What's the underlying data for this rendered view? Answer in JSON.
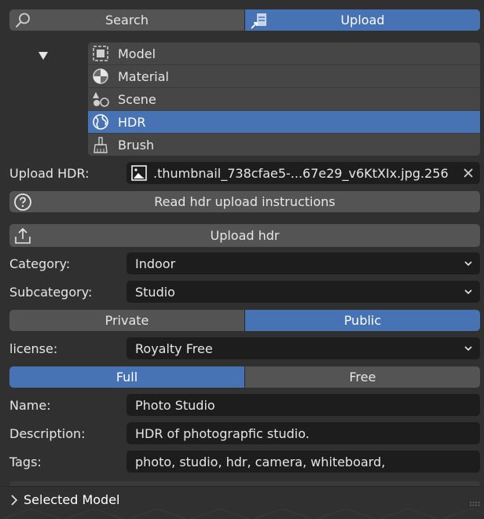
{
  "header": {
    "search_label": "Search",
    "upload_label": "Upload",
    "active": "Upload"
  },
  "asset_types": [
    {
      "label": "Model",
      "icon": "model-icon"
    },
    {
      "label": "Material",
      "icon": "material-icon"
    },
    {
      "label": "Scene",
      "icon": "scene-icon"
    },
    {
      "label": "HDR",
      "icon": "hdr-globe-icon",
      "active": true
    },
    {
      "label": "Brush",
      "icon": "brush-icon"
    }
  ],
  "upload_file": {
    "label": "Upload HDR:",
    "filename": ".thumbnail_738cfae5-...67e29_v6KtXIx.jpg.256"
  },
  "instructions_button": "Read hdr upload instructions",
  "upload_button": "Upload hdr",
  "category": {
    "label": "Category:",
    "value": "Indoor"
  },
  "subcategory": {
    "label": "Subcategory:",
    "value": "Studio"
  },
  "visibility": {
    "private_label": "Private",
    "public_label": "Public",
    "active": "Public"
  },
  "license": {
    "label": "license:",
    "value": "Royalty Free"
  },
  "plan": {
    "full_label": "Full",
    "free_label": "Free",
    "active": "Full"
  },
  "name": {
    "label": "Name:",
    "value": "Photo Studio"
  },
  "description": {
    "label": "Description:",
    "value": "HDR of photograpfic studio."
  },
  "tags": {
    "label": "Tags:",
    "value": "photo, studio, hdr, camera, whiteboard,"
  },
  "footer": {
    "section_label": "Selected Model"
  },
  "colors": {
    "accent": "#4772b3",
    "background": "#303030",
    "button": "#545454",
    "field": "#1d1d1d"
  }
}
